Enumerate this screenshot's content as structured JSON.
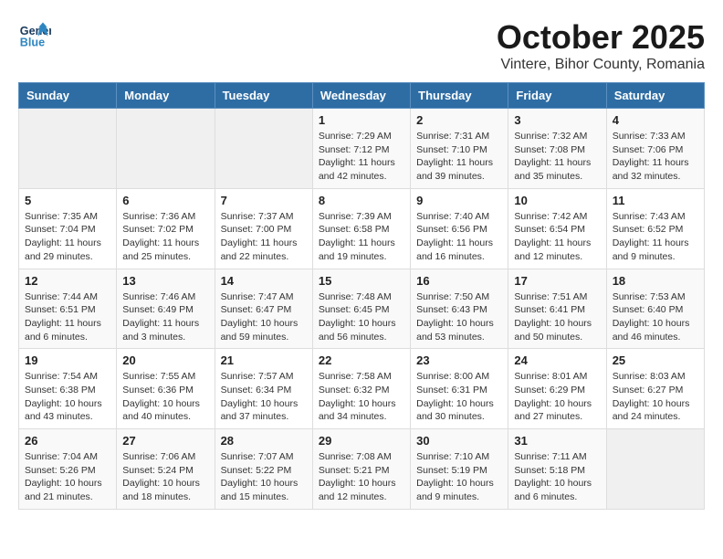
{
  "header": {
    "logo_line1": "General",
    "logo_line2": "Blue",
    "month": "October 2025",
    "location": "Vintere, Bihor County, Romania"
  },
  "weekdays": [
    "Sunday",
    "Monday",
    "Tuesday",
    "Wednesday",
    "Thursday",
    "Friday",
    "Saturday"
  ],
  "weeks": [
    [
      {
        "day": "",
        "info": ""
      },
      {
        "day": "",
        "info": ""
      },
      {
        "day": "",
        "info": ""
      },
      {
        "day": "1",
        "info": "Sunrise: 7:29 AM\nSunset: 7:12 PM\nDaylight: 11 hours\nand 42 minutes."
      },
      {
        "day": "2",
        "info": "Sunrise: 7:31 AM\nSunset: 7:10 PM\nDaylight: 11 hours\nand 39 minutes."
      },
      {
        "day": "3",
        "info": "Sunrise: 7:32 AM\nSunset: 7:08 PM\nDaylight: 11 hours\nand 35 minutes."
      },
      {
        "day": "4",
        "info": "Sunrise: 7:33 AM\nSunset: 7:06 PM\nDaylight: 11 hours\nand 32 minutes."
      }
    ],
    [
      {
        "day": "5",
        "info": "Sunrise: 7:35 AM\nSunset: 7:04 PM\nDaylight: 11 hours\nand 29 minutes."
      },
      {
        "day": "6",
        "info": "Sunrise: 7:36 AM\nSunset: 7:02 PM\nDaylight: 11 hours\nand 25 minutes."
      },
      {
        "day": "7",
        "info": "Sunrise: 7:37 AM\nSunset: 7:00 PM\nDaylight: 11 hours\nand 22 minutes."
      },
      {
        "day": "8",
        "info": "Sunrise: 7:39 AM\nSunset: 6:58 PM\nDaylight: 11 hours\nand 19 minutes."
      },
      {
        "day": "9",
        "info": "Sunrise: 7:40 AM\nSunset: 6:56 PM\nDaylight: 11 hours\nand 16 minutes."
      },
      {
        "day": "10",
        "info": "Sunrise: 7:42 AM\nSunset: 6:54 PM\nDaylight: 11 hours\nand 12 minutes."
      },
      {
        "day": "11",
        "info": "Sunrise: 7:43 AM\nSunset: 6:52 PM\nDaylight: 11 hours\nand 9 minutes."
      }
    ],
    [
      {
        "day": "12",
        "info": "Sunrise: 7:44 AM\nSunset: 6:51 PM\nDaylight: 11 hours\nand 6 minutes."
      },
      {
        "day": "13",
        "info": "Sunrise: 7:46 AM\nSunset: 6:49 PM\nDaylight: 11 hours\nand 3 minutes."
      },
      {
        "day": "14",
        "info": "Sunrise: 7:47 AM\nSunset: 6:47 PM\nDaylight: 10 hours\nand 59 minutes."
      },
      {
        "day": "15",
        "info": "Sunrise: 7:48 AM\nSunset: 6:45 PM\nDaylight: 10 hours\nand 56 minutes."
      },
      {
        "day": "16",
        "info": "Sunrise: 7:50 AM\nSunset: 6:43 PM\nDaylight: 10 hours\nand 53 minutes."
      },
      {
        "day": "17",
        "info": "Sunrise: 7:51 AM\nSunset: 6:41 PM\nDaylight: 10 hours\nand 50 minutes."
      },
      {
        "day": "18",
        "info": "Sunrise: 7:53 AM\nSunset: 6:40 PM\nDaylight: 10 hours\nand 46 minutes."
      }
    ],
    [
      {
        "day": "19",
        "info": "Sunrise: 7:54 AM\nSunset: 6:38 PM\nDaylight: 10 hours\nand 43 minutes."
      },
      {
        "day": "20",
        "info": "Sunrise: 7:55 AM\nSunset: 6:36 PM\nDaylight: 10 hours\nand 40 minutes."
      },
      {
        "day": "21",
        "info": "Sunrise: 7:57 AM\nSunset: 6:34 PM\nDaylight: 10 hours\nand 37 minutes."
      },
      {
        "day": "22",
        "info": "Sunrise: 7:58 AM\nSunset: 6:32 PM\nDaylight: 10 hours\nand 34 minutes."
      },
      {
        "day": "23",
        "info": "Sunrise: 8:00 AM\nSunset: 6:31 PM\nDaylight: 10 hours\nand 30 minutes."
      },
      {
        "day": "24",
        "info": "Sunrise: 8:01 AM\nSunset: 6:29 PM\nDaylight: 10 hours\nand 27 minutes."
      },
      {
        "day": "25",
        "info": "Sunrise: 8:03 AM\nSunset: 6:27 PM\nDaylight: 10 hours\nand 24 minutes."
      }
    ],
    [
      {
        "day": "26",
        "info": "Sunrise: 7:04 AM\nSunset: 5:26 PM\nDaylight: 10 hours\nand 21 minutes."
      },
      {
        "day": "27",
        "info": "Sunrise: 7:06 AM\nSunset: 5:24 PM\nDaylight: 10 hours\nand 18 minutes."
      },
      {
        "day": "28",
        "info": "Sunrise: 7:07 AM\nSunset: 5:22 PM\nDaylight: 10 hours\nand 15 minutes."
      },
      {
        "day": "29",
        "info": "Sunrise: 7:08 AM\nSunset: 5:21 PM\nDaylight: 10 hours\nand 12 minutes."
      },
      {
        "day": "30",
        "info": "Sunrise: 7:10 AM\nSunset: 5:19 PM\nDaylight: 10 hours\nand 9 minutes."
      },
      {
        "day": "31",
        "info": "Sunrise: 7:11 AM\nSunset: 5:18 PM\nDaylight: 10 hours\nand 6 minutes."
      },
      {
        "day": "",
        "info": ""
      }
    ]
  ]
}
